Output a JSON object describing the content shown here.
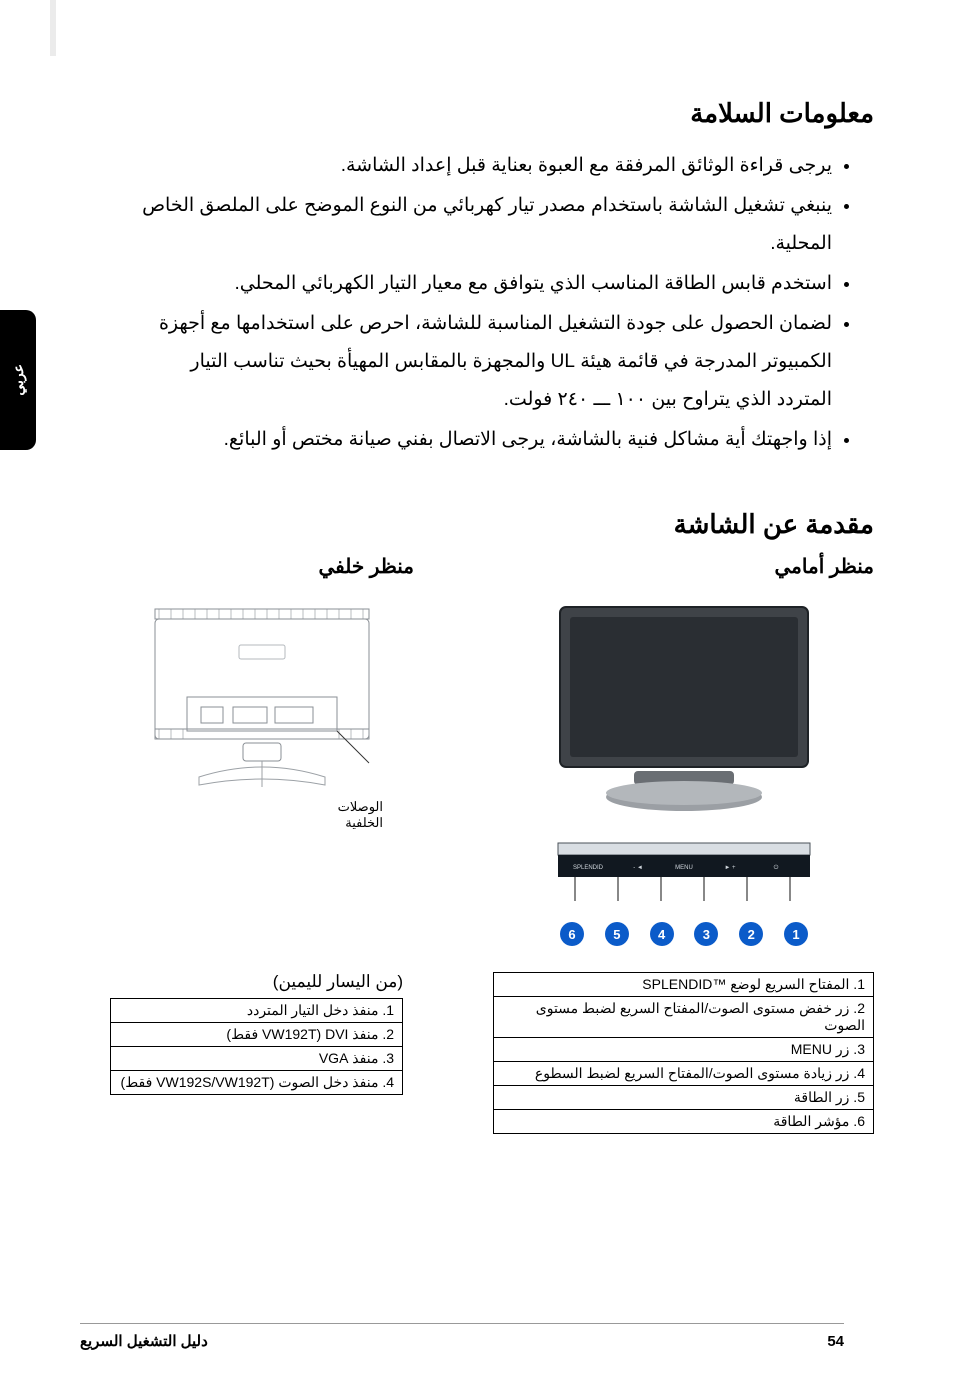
{
  "side_tab": "عربي",
  "safety": {
    "heading": "معلومات السلامة",
    "bullets": [
      "يرجى قراءة الوثائق المرفقة مع العبوة بعناية قبل إعداد الشاشة.",
      "ينبغي تشغيل الشاشة باستخدام مصدر تيار كهربائي من النوع الموضح على الملصق الخاص المحلية.",
      "استخدم قابس الطاقة المناسب الذي يتوافق مع معيار التيار الكهربائي المحلي.",
      "لضمان الحصول على جودة التشغيل المناسبة للشاشة، احرص على استخدامها مع أجهزة الكمبيوتر المدرجة في قائمة هيئة UL والمجهزة بالمقابس المهيأة بحيث تناسب التيار المتردد الذي يتراوح بين ١٠٠ ـــ ٢٤٠ فولت.",
      "إذا واجهتك أية مشاكل فنية بالشاشة، يرجى الاتصال بفني صيانة مختص أو البائع."
    ]
  },
  "intro": {
    "heading": "مقدمة عن الشاشة",
    "front_title": "منظر أمامي",
    "rear_title": "منظر خلفي",
    "rear_label_l1": "الوصلات",
    "rear_label_l2": "الخلفية",
    "panel_labels": [
      "SPLENDID",
      "◄ -",
      "MENU",
      "+ ►",
      "⏻"
    ],
    "callout_numbers": [
      "1",
      "2",
      "3",
      "4",
      "5",
      "6"
    ]
  },
  "front_table": {
    "caption": "",
    "rows": [
      "1. المفتاح السريع لوضع ™SPLENDID",
      "2. زر خفض مستوى الصوت/المفتاح السريع لضبط مستوى الصوت",
      "3. زر MENU",
      "4. زر زيادة مستوى الصوت/المفتاح السريع لضبط السطوع",
      "5. زر الطاقة",
      "6. مؤشر الطاقة"
    ]
  },
  "rear_table": {
    "caption": "(من اليسار لليمين)",
    "rows": [
      "1. منفذ دخل التيار المتردد",
      "2. منفذ DVI (VW192T فقط)",
      "3. منفذ VGA",
      "4. منفذ دخل الصوت (VW192S/VW192T فقط)"
    ]
  },
  "footer": {
    "title": "دليل التشغيل السريع",
    "page": "54"
  }
}
